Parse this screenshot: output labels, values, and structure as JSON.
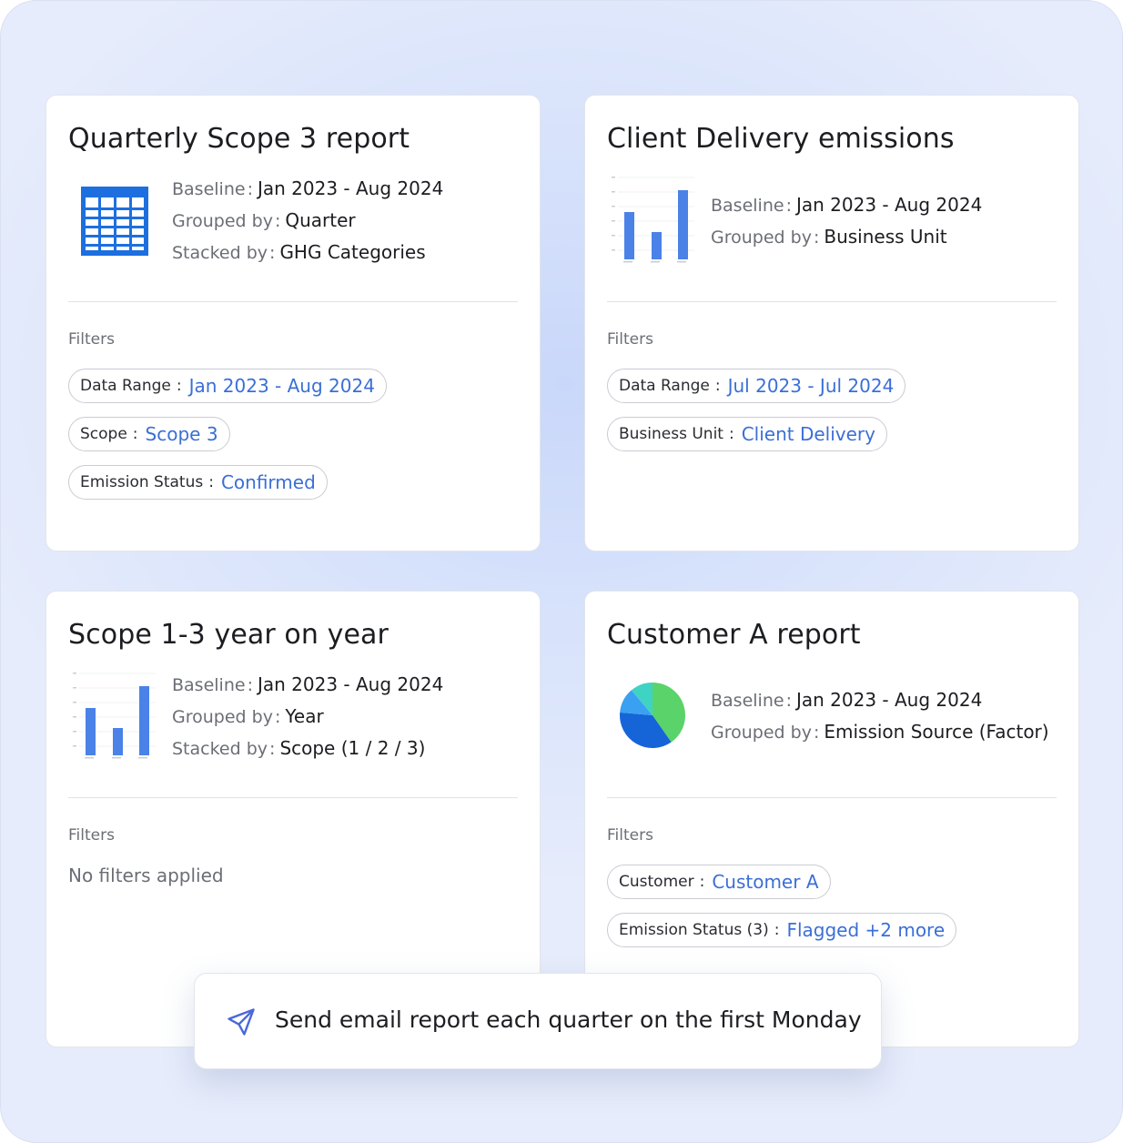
{
  "cards": [
    {
      "title": "Quarterly Scope 3 report",
      "meta": [
        {
          "key": "Baseline",
          "value": "Jan 2023 - Aug 2024"
        },
        {
          "key": "Grouped by",
          "value": "Quarter"
        },
        {
          "key": "Stacked by",
          "value": "GHG Categories"
        }
      ],
      "filters_label": "Filters",
      "filters": [
        {
          "key": "Data Range",
          "value": "Jan 2023 - Aug 2024"
        },
        {
          "key": "Scope",
          "value": "Scope 3"
        },
        {
          "key": "Emission Status",
          "value": "Confirmed"
        }
      ]
    },
    {
      "title": "Client Delivery emissions",
      "meta": [
        {
          "key": "Baseline",
          "value": "Jan 2023 - Aug 2024"
        },
        {
          "key": "Grouped by",
          "value": "Business Unit"
        }
      ],
      "filters_label": "Filters",
      "filters": [
        {
          "key": "Data Range",
          "value": "Jul 2023 - Jul 2024"
        },
        {
          "key": "Business Unit",
          "value": "Client Delivery"
        }
      ]
    },
    {
      "title": "Scope 1-3 year on year",
      "meta": [
        {
          "key": "Baseline",
          "value": "Jan 2023 - Aug 2024"
        },
        {
          "key": "Grouped by",
          "value": "Year"
        },
        {
          "key": "Stacked by",
          "value": "Scope (1 / 2 / 3)"
        }
      ],
      "filters_label": "Filters",
      "no_filters": "No filters applied"
    },
    {
      "title": "Customer A report",
      "meta": [
        {
          "key": "Baseline",
          "value": "Jan 2023 - Aug 2024"
        },
        {
          "key": "Grouped by",
          "value": "Emission Source (Factor)"
        }
      ],
      "filters_label": "Filters",
      "filters": [
        {
          "key": "Customer",
          "value": "Customer A"
        },
        {
          "key": "Emission Status (3)",
          "value": "Flagged +2 more"
        }
      ]
    }
  ],
  "separator": ":",
  "email_bar": {
    "text": "Send email report each quarter on the first Monday"
  },
  "icons": {
    "card0": "table-icon",
    "card1": "bar-chart-icon",
    "card2": "bar-chart-icon",
    "card3": "pie-chart-icon",
    "email": "send-icon"
  },
  "colors": {
    "accent": "#3a6fd6",
    "bar": "#4a82e8",
    "table_blue": "#1d6fe0",
    "pie": [
      "#5ad36a",
      "#1565d8",
      "#3aa0f2",
      "#3fd3c4"
    ]
  }
}
